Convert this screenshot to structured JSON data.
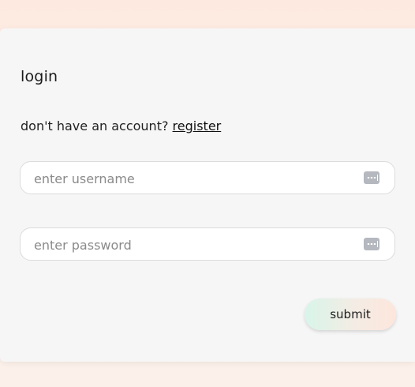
{
  "form": {
    "title": "login",
    "register_prompt": "don't have an account?",
    "register_link": "register",
    "username": {
      "placeholder": "enter username",
      "value": "",
      "icon": "keyboard-icon"
    },
    "password": {
      "placeholder": "enter password",
      "value": "",
      "icon": "keyboard-icon"
    },
    "submit_label": "submit"
  },
  "colors": {
    "page_background": "#fde9df",
    "card_background": "#f6f6f6",
    "submit_gradient_start": "#d8f5ea",
    "submit_gradient_end": "#fde6dc",
    "icon_gray": "#b5b8bf"
  }
}
